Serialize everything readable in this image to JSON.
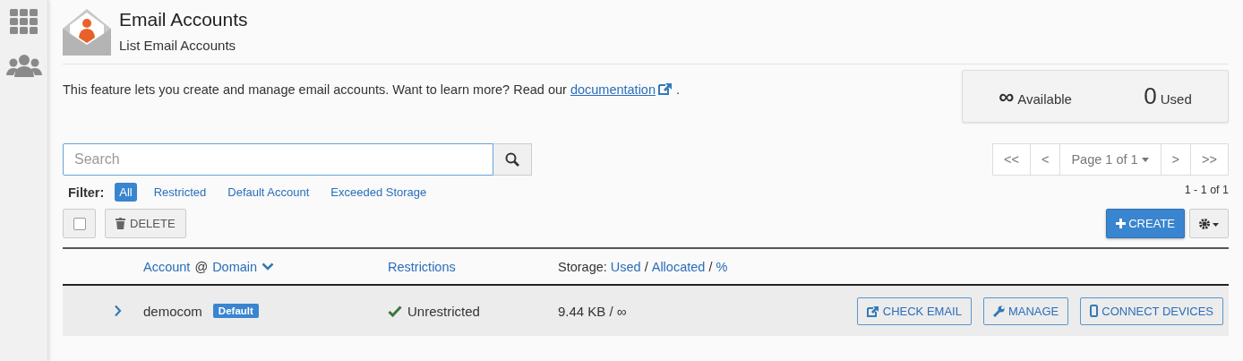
{
  "header": {
    "title": "Email Accounts",
    "subtitle": "List Email Accounts"
  },
  "description": {
    "text": "This feature lets you create and manage email accounts. Want to learn more? Read our",
    "link": "documentation",
    "end": "."
  },
  "stats": [
    {
      "value": "∞",
      "label": "Available",
      "kind": "symbol"
    },
    {
      "value": "0",
      "label": "Used",
      "kind": "number"
    }
  ],
  "search": {
    "placeholder": "Search"
  },
  "pagination": {
    "first": "<<",
    "prev": "<",
    "page": "Page 1 of 1",
    "next": ">",
    "last": ">>",
    "range": "1 - 1 of 1"
  },
  "filter": {
    "label": "Filter:",
    "options": [
      {
        "label": "All",
        "selected": true
      },
      {
        "label": "Restricted",
        "selected": false
      },
      {
        "label": "Default Account",
        "selected": false
      },
      {
        "label": "Exceeded Storage",
        "selected": false
      }
    ]
  },
  "toolbar": {
    "select_all": {
      "checked": false
    },
    "delete": "DELETE",
    "create": "CREATE"
  },
  "table": {
    "columns": {
      "account": "Account",
      "at": "@",
      "domain": "Domain",
      "restrictions": "Restrictions",
      "storage": "Storage:",
      "used": "Used",
      "sep1": "/",
      "allocated": "Allocated",
      "sep2": "/",
      "percent": "%"
    },
    "rows": [
      {
        "expanded": false,
        "account": "democom",
        "badge": "Default",
        "restricted": false,
        "restriction": "Unrestricted",
        "storage": "9.44 KB / ∞",
        "actions": [
          {
            "kind": "check",
            "label": "CHECK EMAIL"
          },
          {
            "kind": "manage",
            "label": "MANAGE"
          },
          {
            "kind": "devices",
            "label": "CONNECT DEVICES"
          }
        ]
      }
    ]
  }
}
